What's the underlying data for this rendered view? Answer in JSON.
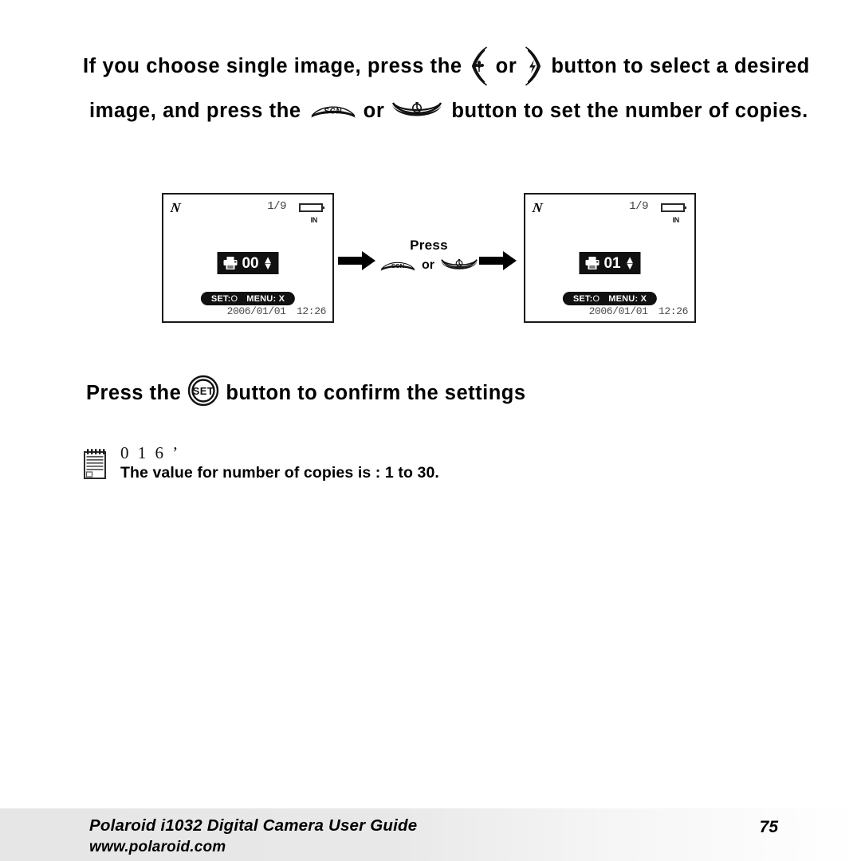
{
  "page": {
    "background": "#ffffff",
    "accent": "#000000"
  },
  "instructions": {
    "line1": {
      "part1": "If you choose single image, press the",
      "or": "or",
      "part2": "button to select a desired",
      "left_button_icon": "macro-flower-button-icon",
      "right_button_icon": "flash-lightning-button-icon"
    },
    "line2": {
      "part1": "image, and press  the",
      "or": "or",
      "part2": "button to set the number of copies.",
      "left_button_icon": "scn-scene-button-icon",
      "left_button_label": "SCN",
      "right_button_icon": "self-timer-button-icon"
    }
  },
  "diagram": {
    "screen_before": {
      "mode_icon": "playback-mode-icon",
      "mode_icon_label": "N",
      "counter": "1/9",
      "battery_icon": "battery-empty-icon",
      "storage_label": "IN",
      "printer_icon": "printer-icon",
      "copies_value": "00",
      "spinner_up": "▲",
      "spinner_down": "▼",
      "set_label": "SET:",
      "set_symbol": "O",
      "menu_label": "MENU:",
      "menu_symbol": "X",
      "date": "2006/01/01",
      "time": "12:26"
    },
    "press_group": {
      "label": "Press",
      "or": "or",
      "left_button_icon": "scn-scene-button-icon",
      "left_button_label": "SCN",
      "right_button_icon": "self-timer-button-icon"
    },
    "screen_after": {
      "mode_icon": "playback-mode-icon",
      "mode_icon_label": "N",
      "counter": "1/9",
      "battery_icon": "battery-empty-icon",
      "storage_label": "IN",
      "printer_icon": "printer-icon",
      "copies_value": "01",
      "spinner_up": "▲",
      "spinner_down": "▼",
      "set_label": "SET:",
      "set_symbol": "O",
      "menu_label": "MENU:",
      "menu_symbol": "X",
      "date": "2006/01/01",
      "time": "12:26"
    },
    "arrow_icon": "right-arrow-icon"
  },
  "confirm": {
    "part1": "Press the",
    "part2": "button to confirm the settings",
    "set_button_icon": "set-button-icon",
    "set_button_label": "SET"
  },
  "note": {
    "icon": "notepad-icon",
    "heading": "0 1 6 ’",
    "body": "The  value for number of copies is : 1 to 30."
  },
  "footer": {
    "title": "Polaroid i1032 Digital Camera User Guide",
    "url": "www.polaroid.com",
    "page_number": "75"
  }
}
